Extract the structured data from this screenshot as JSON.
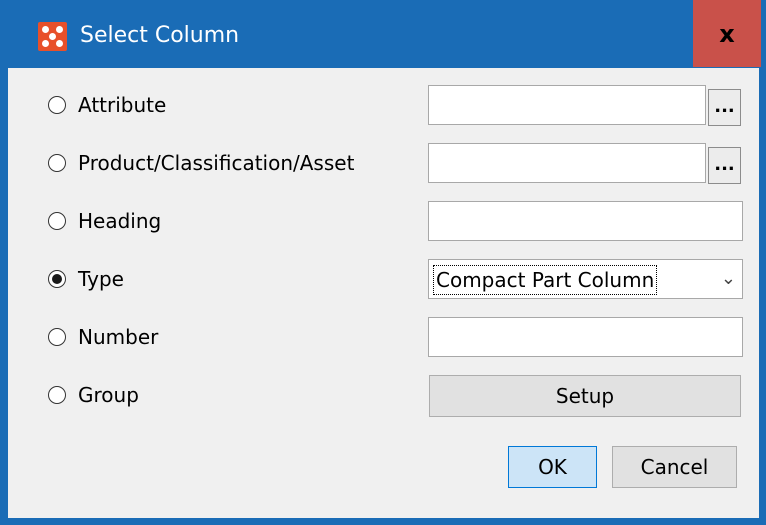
{
  "window": {
    "title": "Select Column",
    "app_icon": "app-logo-icon",
    "close_label": "x",
    "accent_color": "#1a6cb6",
    "close_color": "#c9514a"
  },
  "options": [
    {
      "label": "Attribute",
      "checked": false
    },
    {
      "label": "Product/Classification/Asset",
      "checked": false
    },
    {
      "label": "Heading",
      "checked": false
    },
    {
      "label": "Type",
      "checked": true
    },
    {
      "label": "Number",
      "checked": false
    },
    {
      "label": "Group",
      "checked": false
    }
  ],
  "fields": {
    "attribute_value": "",
    "attribute_browse": "...",
    "product_value": "",
    "product_browse": "...",
    "heading_value": "",
    "type_selected": "Compact Part Column",
    "number_value": "",
    "group_setup": "Setup"
  },
  "buttons": {
    "ok": "OK",
    "cancel": "Cancel"
  }
}
